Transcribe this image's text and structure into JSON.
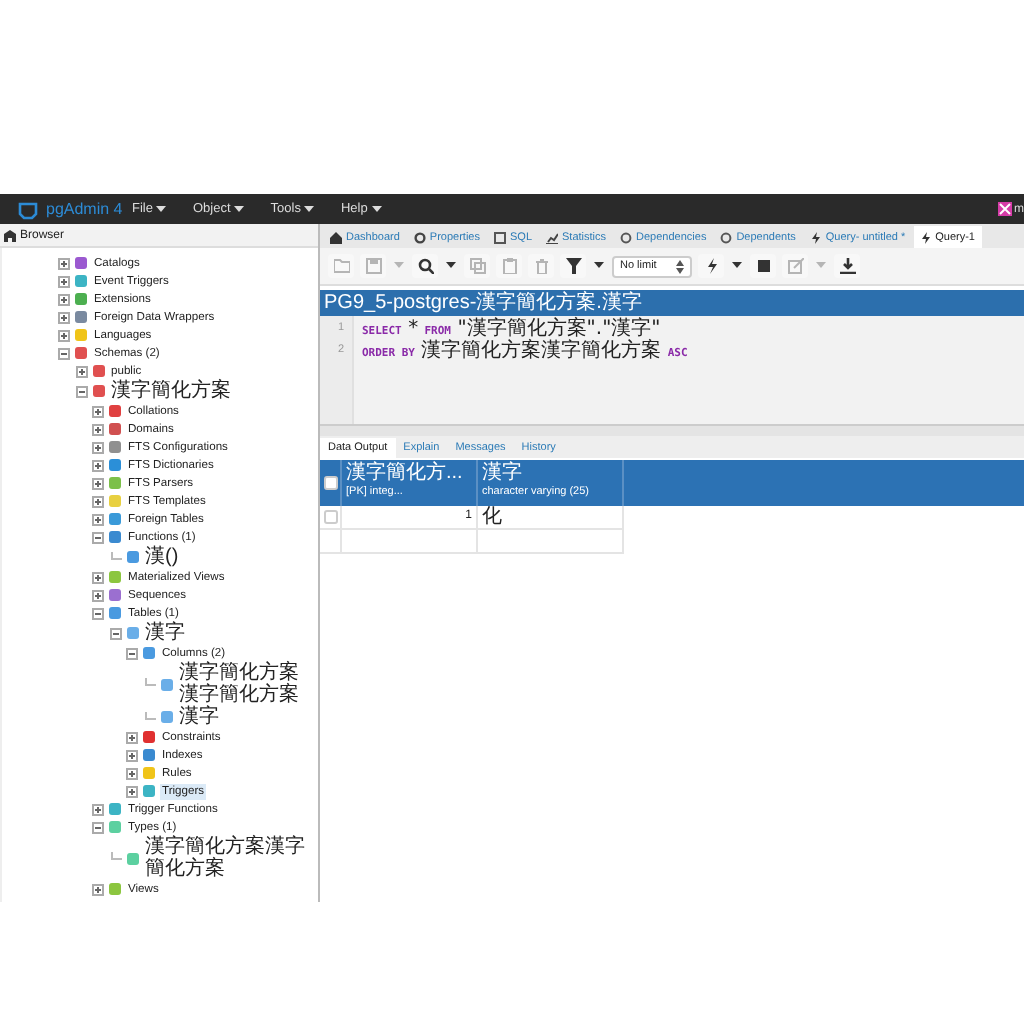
{
  "app": {
    "title": "pgAdmin 4",
    "menus": [
      "File",
      "Object",
      "Tools",
      "Help"
    ],
    "user": "m"
  },
  "browser": {
    "title": "Browser",
    "tree": [
      {
        "label": "Catalogs",
        "kind": "folder",
        "expanded": false,
        "selected": false,
        "color": "#9b59d0"
      },
      {
        "label": "Event Triggers",
        "kind": "folder",
        "expanded": false,
        "selected": false,
        "color": "#3cb4c4"
      },
      {
        "label": "Extensions",
        "kind": "folder",
        "expanded": false,
        "selected": false,
        "color": "#4caf50"
      },
      {
        "label": "Foreign Data Wrappers",
        "kind": "folder",
        "expanded": false,
        "selected": false,
        "color": "#7a8aa0"
      },
      {
        "label": "Languages",
        "kind": "folder",
        "expanded": false,
        "selected": false,
        "color": "#f0c419"
      },
      {
        "label": "Schemas (2)",
        "kind": "folder",
        "expanded": true,
        "selected": false,
        "color": "#e05050",
        "children": [
          {
            "label": "public",
            "kind": "folder",
            "expanded": false,
            "selected": false,
            "color": "#e05050"
          },
          {
            "label": "漢字簡化方案",
            "kind": "folder",
            "expanded": true,
            "selected": false,
            "color": "#e05050",
            "children": [
              {
                "label": "Collations",
                "kind": "folder",
                "expanded": false,
                "selected": false,
                "color": "#e04040"
              },
              {
                "label": "Domains",
                "kind": "folder",
                "expanded": false,
                "selected": false,
                "color": "#d05050"
              },
              {
                "label": "FTS Configurations",
                "kind": "folder",
                "expanded": false,
                "selected": false,
                "color": "#909090"
              },
              {
                "label": "FTS Dictionaries",
                "kind": "folder",
                "expanded": false,
                "selected": false,
                "color": "#2b8fd8"
              },
              {
                "label": "FTS Parsers",
                "kind": "folder",
                "expanded": false,
                "selected": false,
                "color": "#7cc04a"
              },
              {
                "label": "FTS Templates",
                "kind": "folder",
                "expanded": false,
                "selected": false,
                "color": "#e8d040"
              },
              {
                "label": "Foreign Tables",
                "kind": "folder",
                "expanded": false,
                "selected": false,
                "color": "#3a9ad9"
              },
              {
                "label": "Functions (1)",
                "kind": "folder",
                "expanded": true,
                "selected": false,
                "color": "#3a8ad0",
                "children": [
                  {
                    "label": "漢()",
                    "kind": "leaf",
                    "selected": false,
                    "color": "#4a9ae0"
                  }
                ]
              },
              {
                "label": "Materialized Views",
                "kind": "folder",
                "expanded": false,
                "selected": false,
                "color": "#8cc63f"
              },
              {
                "label": "Sequences",
                "kind": "folder",
                "expanded": false,
                "selected": false,
                "color": "#9b6fd0"
              },
              {
                "label": "Tables (1)",
                "kind": "folder",
                "expanded": true,
                "selected": false,
                "color": "#4a9ae0",
                "children": [
                  {
                    "label": "漢字",
                    "kind": "folder",
                    "expanded": true,
                    "selected": false,
                    "color": "#6aaee8",
                    "children": [
                      {
                        "label": "Columns (2)",
                        "kind": "folder",
                        "expanded": true,
                        "selected": false,
                        "color": "#4a9ae0",
                        "children": [
                          {
                            "label": "漢字簡化方案漢字簡化方案",
                            "kind": "leaf",
                            "selected": false,
                            "color": "#6aaee8"
                          },
                          {
                            "label": "漢字",
                            "kind": "leaf",
                            "selected": false,
                            "color": "#6aaee8"
                          }
                        ]
                      },
                      {
                        "label": "Constraints",
                        "kind": "folder",
                        "expanded": false,
                        "selected": false,
                        "color": "#e03030"
                      },
                      {
                        "label": "Indexes",
                        "kind": "folder",
                        "expanded": false,
                        "selected": false,
                        "color": "#3a8ad0"
                      },
                      {
                        "label": "Rules",
                        "kind": "folder",
                        "expanded": false,
                        "selected": false,
                        "color": "#f0c419"
                      },
                      {
                        "label": "Triggers",
                        "kind": "folder",
                        "expanded": false,
                        "selected": true,
                        "color": "#3cb4c4"
                      }
                    ]
                  }
                ]
              },
              {
                "label": "Trigger Functions",
                "kind": "folder",
                "expanded": false,
                "selected": false,
                "color": "#3cb4c4"
              },
              {
                "label": "Types (1)",
                "kind": "folder",
                "expanded": true,
                "selected": false,
                "color": "#5cd0a0",
                "children": [
                  {
                    "label": "漢字簡化方案漢字簡化方案",
                    "kind": "leaf",
                    "selected": false,
                    "color": "#5cd0a0"
                  }
                ]
              },
              {
                "label": "Views",
                "kind": "folder",
                "expanded": false,
                "selected": false,
                "color": "#8cc63f"
              }
            ]
          }
        ]
      }
    ]
  },
  "tabs": [
    {
      "label": "Dashboard",
      "selected": false
    },
    {
      "label": "Properties",
      "selected": false
    },
    {
      "label": "SQL",
      "selected": false
    },
    {
      "label": "Statistics",
      "selected": false
    },
    {
      "label": "Dependencies",
      "selected": false
    },
    {
      "label": "Dependents",
      "selected": false
    },
    {
      "label": "Query- untitled *",
      "selected": false
    },
    {
      "label": "Query-1",
      "selected": true
    }
  ],
  "toolbar": [
    {
      "kind": "button",
      "disabled": true
    },
    {
      "kind": "button",
      "disabled": true
    },
    {
      "kind": "dropdown",
      "disabled": true
    },
    {
      "kind": "button",
      "disabled": false
    },
    {
      "kind": "dropdown",
      "disabled": false
    },
    {
      "kind": "button",
      "disabled": true
    },
    {
      "kind": "button",
      "disabled": true
    },
    {
      "kind": "button",
      "disabled": true
    },
    {
      "kind": "button",
      "disabled": false
    },
    {
      "kind": "dropdown",
      "disabled": false
    },
    {
      "kind": "select",
      "value": "No limit"
    },
    {
      "kind": "button",
      "disabled": false
    },
    {
      "kind": "dropdown",
      "disabled": false
    },
    {
      "kind": "button",
      "disabled": false
    },
    {
      "kind": "button",
      "disabled": true
    },
    {
      "kind": "dropdown",
      "disabled": true
    },
    {
      "kind": "button",
      "disabled": false
    }
  ],
  "query": {
    "title": "PG9_5-postgres-漢字簡化方案.漢字",
    "lines": [
      {
        "number": "1",
        "tokens": [
          {
            "kind": "keyword",
            "text": "SELECT"
          },
          {
            "kind": "plain",
            "text": "*"
          },
          {
            "kind": "keyword",
            "text": "FROM"
          },
          {
            "kind": "plain",
            "text": "\"漢字簡化方案\".\"漢字\""
          }
        ]
      },
      {
        "number": "2",
        "tokens": [
          {
            "kind": "keyword",
            "text": "ORDER BY"
          },
          {
            "kind": "plain",
            "text": "漢字簡化方案漢字簡化方案"
          },
          {
            "kind": "keyword",
            "text": "ASC"
          }
        ]
      }
    ]
  },
  "output": {
    "tabs": [
      {
        "label": "Data Output",
        "selected": true
      },
      {
        "label": "Explain",
        "selected": false
      },
      {
        "label": "Messages",
        "selected": false
      },
      {
        "label": "History",
        "selected": false
      }
    ],
    "select_all": false,
    "columns": [
      {
        "name": "漢字簡化方...",
        "type": "[PK] integ..."
      },
      {
        "name": "漢字",
        "type": "character varying (25)"
      }
    ],
    "rows": [
      {
        "checked": false,
        "cells": [
          "1",
          "化"
        ]
      }
    ]
  }
}
